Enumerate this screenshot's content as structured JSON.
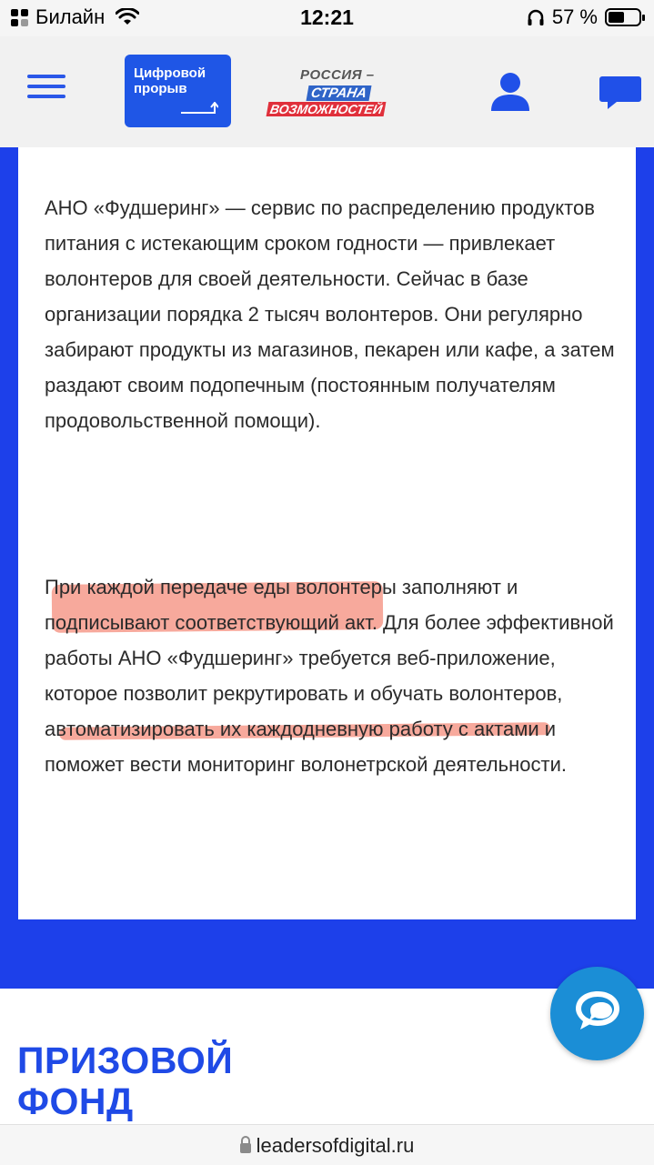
{
  "status_bar": {
    "carrier": "Билайн",
    "time": "12:21",
    "battery_percent": "57 %",
    "battery_level": 0.57
  },
  "header": {
    "logo_cp_line1": "Цифровой",
    "logo_cp_line2": "прорыв",
    "logo_rus_line1": "РОССИЯ –",
    "logo_rus_line2": "СТРАНА",
    "logo_rus_line3": "ВОЗМОЖНОСТЕЙ",
    "accent_color": "#1f56e6"
  },
  "content": {
    "paragraph1": "АНО «Фудшеринг» — сервис по распределению продуктов питания с истекающим сроком годности — привлекает волонтеров для своей деятельности. Сейчас в базе организации порядка 2 тысяч волонтеров. Они регулярно забирают продукты из магазинов, пекарен или кафе, а затем раздают своим подопечным (постоянным получателям продовольственной помощи).",
    "paragraph2_start": "П",
    "paragraph2_hl1": "ри каждой передаче еды волонтеры заполняют и подписывают соответствующий акт",
    "paragraph2_mid": ". Для более эффективной работы АНО «Фудшеринг» требуется веб-приложение, которое позволит рекрутировать и обучать волонтеров, ав",
    "paragraph2_hl2": "томатизировать их каждодневную работу с актами",
    "paragraph2_end": " и поможет вести мониторинг волонетрской деятельности.",
    "highlight_color": "#f27460"
  },
  "prize": {
    "line1": "ПРИЗОВОЙ",
    "line2": "ФОНД"
  },
  "url_bar": {
    "url": "leadersofdigital.ru"
  }
}
